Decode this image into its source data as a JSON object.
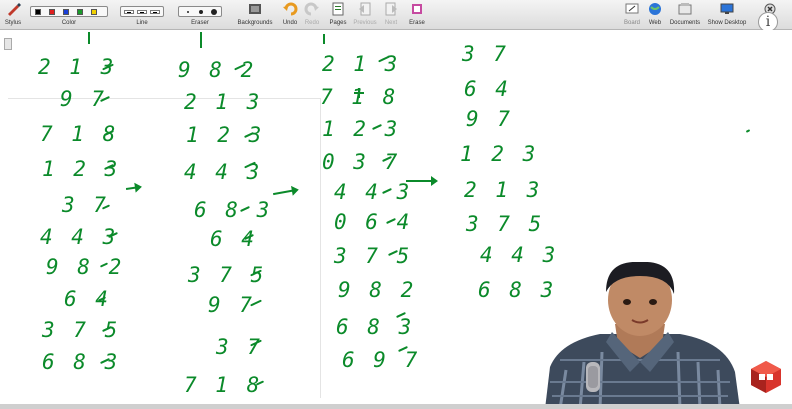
{
  "toolbar": {
    "items": [
      {
        "label": "Stylus",
        "icon": "stylus-icon"
      },
      {
        "label": "Color"
      },
      {
        "label": "Line"
      },
      {
        "label": "Eraser"
      },
      {
        "label": "Backgrounds",
        "icon": "backgrounds-icon"
      },
      {
        "label": "Undo",
        "icon": "undo-icon"
      },
      {
        "label": "Redo",
        "icon": "redo-icon"
      },
      {
        "label": "Pages",
        "icon": "pages-icon"
      },
      {
        "label": "Previous",
        "icon": "previous-icon"
      },
      {
        "label": "Next",
        "icon": "next-icon"
      },
      {
        "label": "Erase",
        "icon": "erase-icon"
      }
    ],
    "right_items": [
      {
        "label": "Board",
        "icon": "board-icon"
      },
      {
        "label": "Web",
        "icon": "web-icon"
      },
      {
        "label": "Documents",
        "icon": "documents-icon"
      },
      {
        "label": "Show Desktop",
        "icon": "show-desktop-icon"
      },
      {
        "label": "Close",
        "icon": "close-icon"
      }
    ],
    "colors": [
      "#000000",
      "#e02020",
      "#1a3fd8",
      "#1a9a2a",
      "#f0d000"
    ]
  },
  "info_button": {
    "symbol": "i"
  },
  "handwriting": {
    "color": "#0b8a2a",
    "col1": [
      "2 1 3",
      "9 7",
      "7 1 8",
      "1 2 3",
      "3 7",
      "4 4 3",
      "9 8 2",
      "6 4",
      "3 7 5",
      "6 8 3"
    ],
    "col2": [
      "9 8 2",
      "2 1 3",
      "1 2 3",
      "4 4 3",
      "6 8 3",
      "6 4",
      "3 7 5",
      "9 7",
      "3 7",
      "7 1 8"
    ],
    "col3": [
      "2 1 3",
      "7 1 8",
      "1 2 3",
      "0 3 7",
      "4 4 3",
      "0 6 4",
      "3 7 5",
      "9 8 2",
      "6 8 3",
      "6 9 7"
    ],
    "col4": [
      "3 7",
      "6 4",
      "9 7",
      "1 2 3",
      "2 1 3",
      "3 7 5",
      "4 4 3",
      "6 8 3"
    ]
  }
}
